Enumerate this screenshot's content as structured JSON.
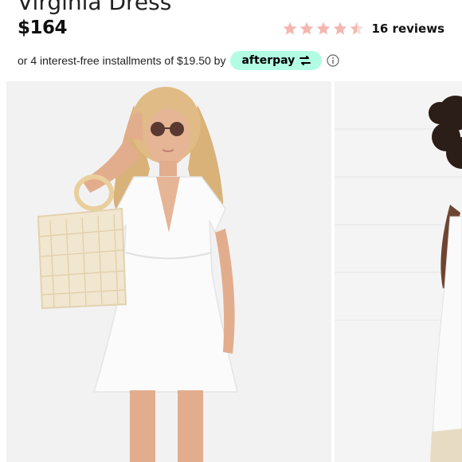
{
  "product": {
    "name": "Virginia Dress",
    "price": "$164",
    "rating": 4.5,
    "reviews_label": "16 reviews"
  },
  "payment": {
    "installments_text": "or 4 interest-free installments of $19.50 by",
    "provider": "afterpay"
  },
  "colors": {
    "star": "#f5b6b0",
    "star_empty": "#f3dcd9",
    "afterpay_bg": "#b2fce4"
  },
  "gallery": {
    "images": [
      {
        "subject": "model-in-white-dress-with-straw-bag"
      },
      {
        "subject": "model-in-white-dress-partial"
      }
    ]
  }
}
